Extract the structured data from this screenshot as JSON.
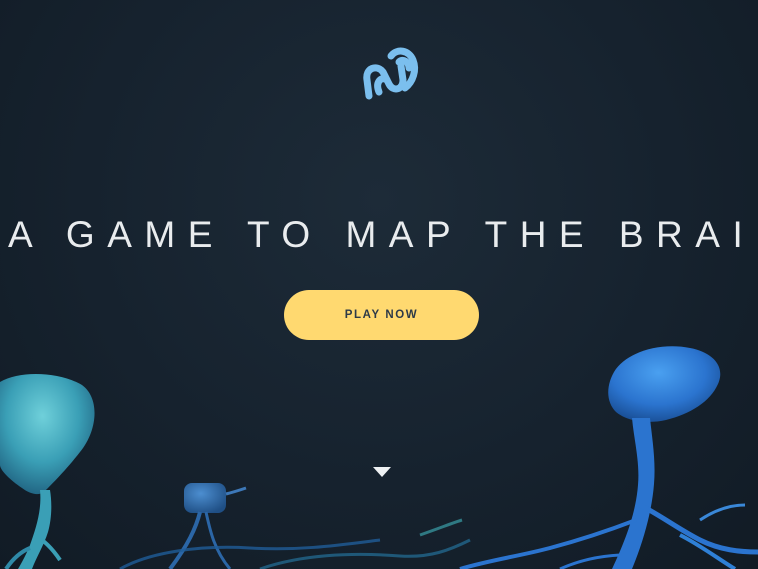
{
  "hero": {
    "logo_icon": "eyewire-logo-icon",
    "tagline": "A GAME TO MAP THE BRAIN",
    "cta_label": "PLAY NOW",
    "scroll_icon": "triangle-down-icon"
  },
  "colors": {
    "background": "#17232f",
    "cta_background": "#ffd970",
    "cta_text": "#2d3a48",
    "logo": "#7bbfee",
    "tagline": "#e9ecee",
    "neuron_teal": "#3fa6b8",
    "neuron_blue": "#2f7fd2"
  }
}
